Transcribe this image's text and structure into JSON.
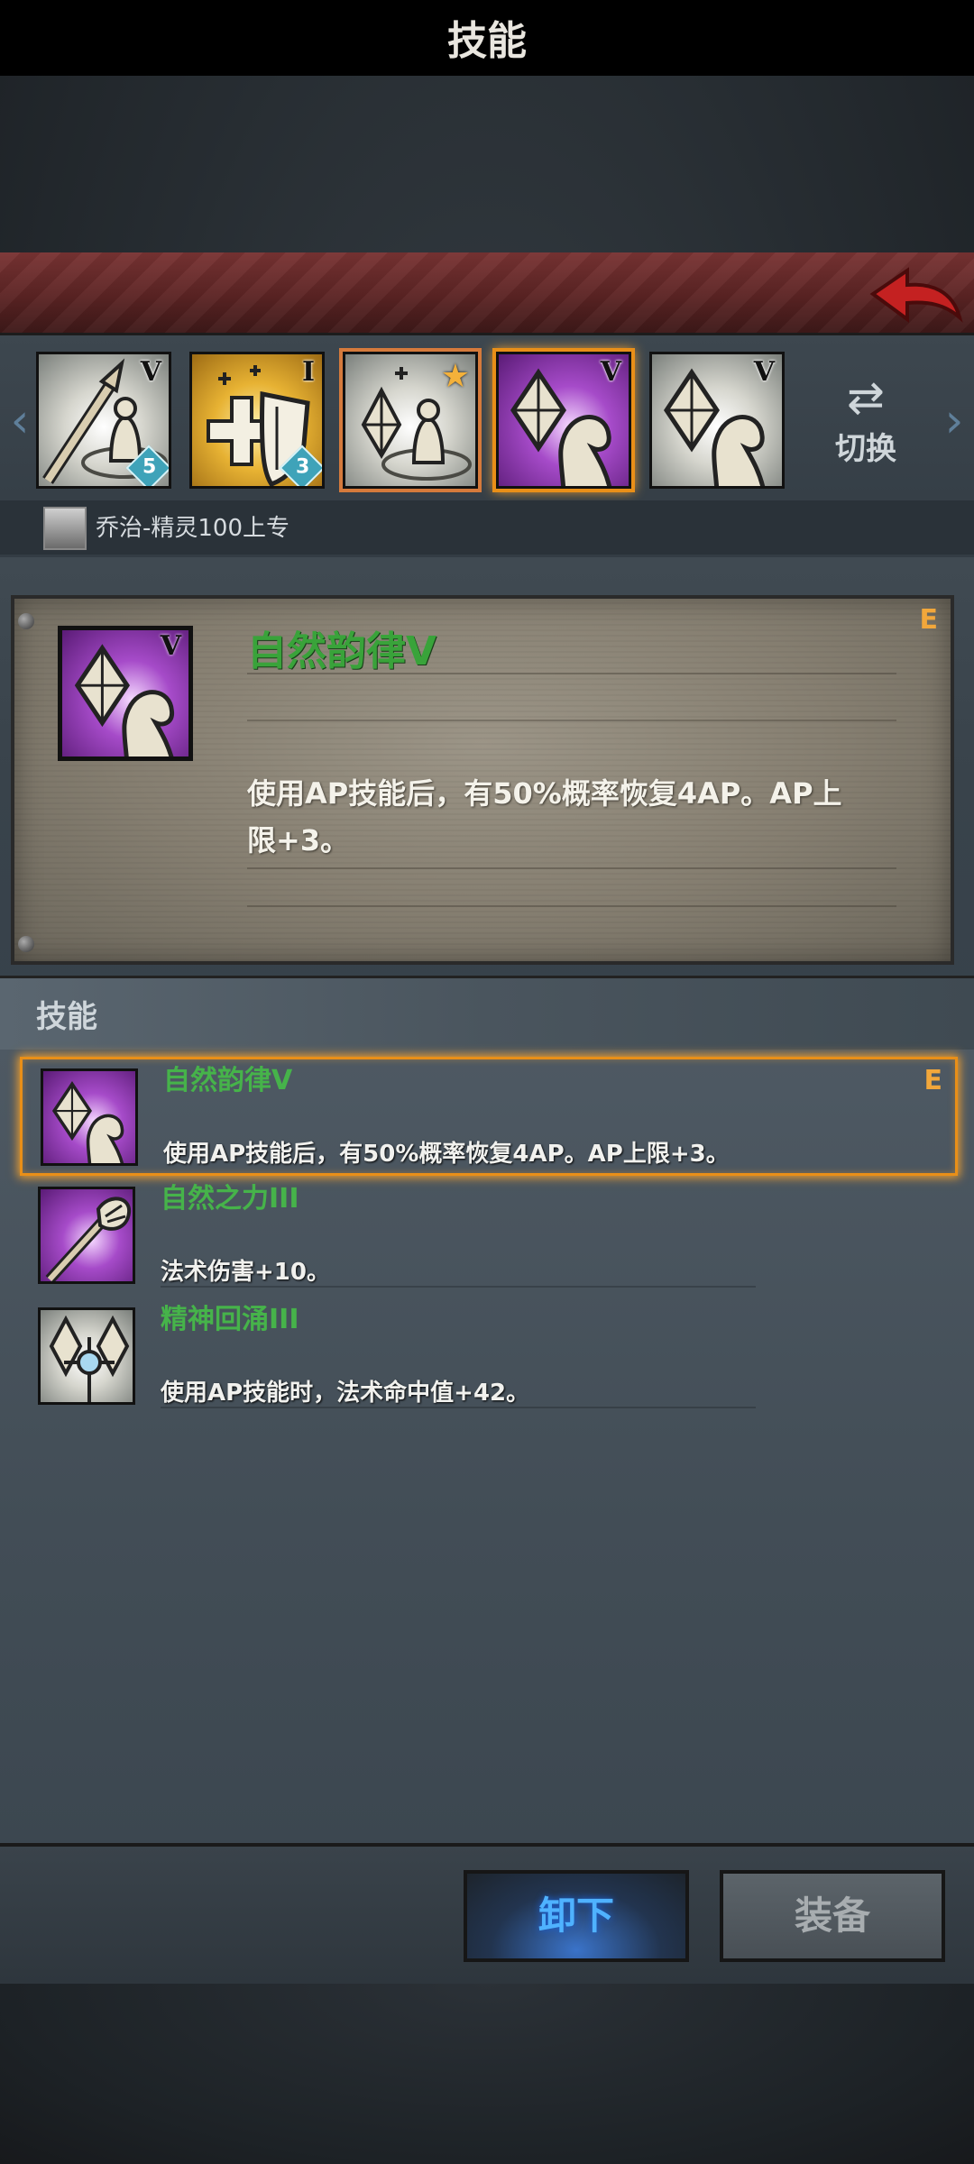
{
  "header": {
    "title": "技能"
  },
  "switch": {
    "icon": "swap-arrows-icon",
    "label": "切换"
  },
  "hero": {
    "name": "乔治-精灵100上专"
  },
  "slots": [
    {
      "roman": "V",
      "level": "5",
      "icon": "staff-pillar-icon"
    },
    {
      "roman": "I",
      "level": "3",
      "icon": "cross-shield-icon"
    },
    {
      "roman": "",
      "level": "",
      "icon": "crystal-pillar-star-icon",
      "starred": true
    },
    {
      "roman": "V",
      "level": "",
      "icon": "crystal-hand-icon"
    },
    {
      "roman": "V",
      "level": "",
      "icon": "crystal-hand-icon"
    }
  ],
  "detail": {
    "grade": "E",
    "roman": "V",
    "title": "自然韵律V",
    "desc_line1": "使用AP技能后，有50%概率恢复4AP。AP上",
    "desc_line2": "限+3。"
  },
  "list": {
    "header": "技能",
    "items": [
      {
        "name": "自然韵律V",
        "desc": "使用AP技能后，有50%概率恢复4AP。AP上限+3。",
        "grade": "E"
      },
      {
        "name": "自然之力III",
        "desc": "法术伤害+10。",
        "grade": ""
      },
      {
        "name": "精神回涌III",
        "desc": "使用AP技能时，法术命中值+42。",
        "grade": ""
      }
    ]
  },
  "buttons": {
    "unequip": "卸下",
    "equip": "装备"
  },
  "colors": {
    "accent_orange": "#e98f18",
    "skill_green": "#46b34a",
    "header_red": "#6e2b2b"
  }
}
